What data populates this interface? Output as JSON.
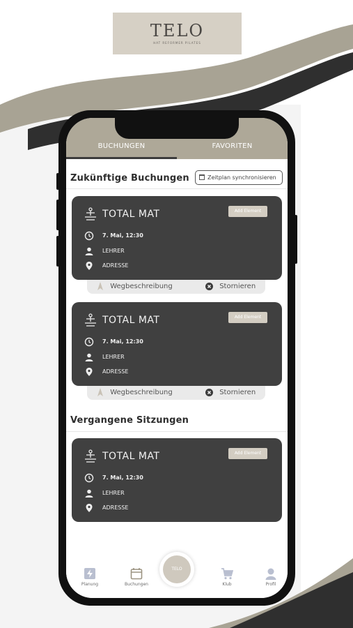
{
  "brand": {
    "name": "TELO",
    "tagline": "HAT REFORMER PILATES",
    "colors": {
      "accent": "#aea898",
      "card": "#404040",
      "logo_bg": "#d6d0c5",
      "badge": "#d3cdc2"
    }
  },
  "tabs": [
    {
      "label": "BUCHUNGEN",
      "active": true
    },
    {
      "label": "FAVORITEN",
      "active": false
    }
  ],
  "upcoming": {
    "title": "Zukünftige Buchungen",
    "sync_button": "Zeitplan synchronisieren",
    "cards": [
      {
        "title": "TOTAL MAT",
        "add_label": "Add Element",
        "datetime": "7. Mai, 12:30",
        "teacher": "LEHRER",
        "address": "ADRESSE",
        "route_label": "Wegbeschreibung",
        "cancel_label": "Stornieren"
      },
      {
        "title": "TOTAL MAT",
        "add_label": "Add Element",
        "datetime": "7. Mai, 12:30",
        "teacher": "LEHRER",
        "address": "ADRESSE",
        "route_label": "Wegbeschreibung",
        "cancel_label": "Stornieren"
      }
    ]
  },
  "past": {
    "title": "Vergangene Sitzungen",
    "cards": [
      {
        "title": "TOTAL MAT",
        "add_label": "Add Element",
        "datetime": "7. Mai, 12:30",
        "teacher": "LEHRER",
        "address": "ADRESSE"
      }
    ]
  },
  "nav": {
    "items": [
      {
        "label": "Planung",
        "icon": "lightning-icon"
      },
      {
        "label": "Buchungen",
        "icon": "calendar-icon"
      },
      {
        "label": "Klub",
        "icon": "cart-icon"
      },
      {
        "label": "Profil",
        "icon": "user-icon"
      }
    ],
    "center_label": "TELO"
  }
}
